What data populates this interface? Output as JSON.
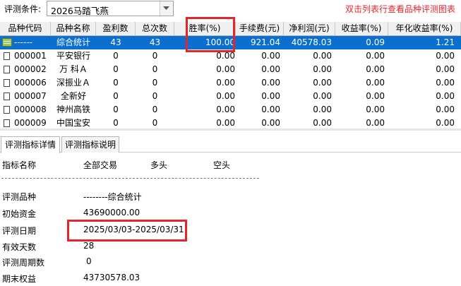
{
  "toolbar": {
    "condition_label": "评测条件:",
    "condition_value": "2026马踏飞燕",
    "hint": "双击列表行查看品种评测图表"
  },
  "table": {
    "columns": [
      "品种代码",
      "品种名称",
      "盈利数",
      "总次数",
      "胜率(%)",
      "手续费(元)",
      "净利润(元)",
      "收益率(%)",
      "年化收益率(%)"
    ],
    "rows": [
      {
        "code": "------",
        "name": "综合统计",
        "wins": "43",
        "total": "43",
        "winrate": "100.00",
        "fee": "921.04",
        "profit": "40578.03",
        "return": "0.09",
        "annual": "1.21",
        "selected": true
      },
      {
        "code": "000001",
        "name": "平安银行",
        "wins": "0",
        "total": "0",
        "winrate": "0.00",
        "fee": "0.00",
        "profit": "0.00",
        "return": "0.00",
        "annual": "0.00"
      },
      {
        "code": "000002",
        "name": "万 科Ａ",
        "wins": "0",
        "total": "0",
        "winrate": "0.00",
        "fee": "0.00",
        "profit": "0.00",
        "return": "0.00",
        "annual": "0.00"
      },
      {
        "code": "000006",
        "name": "深振业Ａ",
        "wins": "0",
        "total": "0",
        "winrate": "0.00",
        "fee": "0.00",
        "profit": "0.00",
        "return": "0.00",
        "annual": "0.00"
      },
      {
        "code": "000007",
        "name": "全新好",
        "wins": "0",
        "total": "0",
        "winrate": "0.00",
        "fee": "0.00",
        "profit": "0.00",
        "return": "0.00",
        "annual": "0.00"
      },
      {
        "code": "000008",
        "name": "神州高铁",
        "wins": "0",
        "total": "0",
        "winrate": "0.00",
        "fee": "0.00",
        "profit": "0.00",
        "return": "0.00",
        "annual": "0.00"
      },
      {
        "code": "000009",
        "name": "中国宝安",
        "wins": "0",
        "total": "0",
        "winrate": "0.00",
        "fee": "0.00",
        "profit": "0.00",
        "return": "0.00",
        "annual": "0.00"
      }
    ]
  },
  "tabs": [
    "评测指标详情",
    "评测指标说明"
  ],
  "detail": {
    "headers": [
      "指标名称",
      "全部交易",
      "多头",
      "空头"
    ],
    "items": [
      {
        "label": "评测品种",
        "value": "--------综合统计"
      },
      {
        "label": "初始资金",
        "value": "43690000.00"
      },
      {
        "label": "评测日期",
        "value": "2025/03/03-2025/03/31"
      },
      {
        "label": "有效天数",
        "value": "28"
      },
      {
        "label": "评测周期数",
        "value": "0"
      },
      {
        "label": "期末权益",
        "value": "43730578.03"
      }
    ]
  },
  "colors": {
    "selection": "#0a6fce",
    "highlight": "#e3262b",
    "hint": "#e3262b"
  }
}
